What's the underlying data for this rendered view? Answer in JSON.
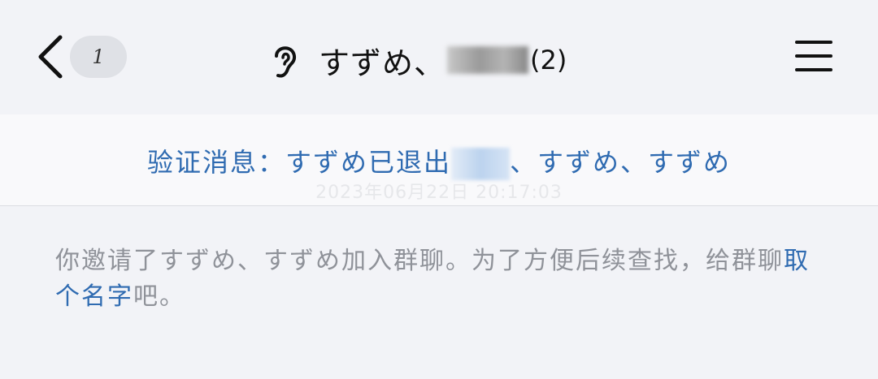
{
  "header": {
    "back_badge": "1",
    "title_prefix": "すずめ、",
    "title_suffix": "(2)",
    "icons": {
      "back": "chevron-left-icon",
      "voice": "ear-icon",
      "menu": "hamburger-menu-icon"
    }
  },
  "notice": {
    "timestamp": "2023年06月22日 20:17:03",
    "message_prefix": "验证消息：すずめ已退出",
    "message_suffix": "、すずめ、すずめ"
  },
  "system_message": {
    "text": "你邀请了すずめ、すずめ加入群聊。为了方便后续查找，给群聊",
    "link_text": "取个名字",
    "tail": "吧。"
  },
  "colors": {
    "background": "#f2f3f7",
    "accent_link": "#2f6bb1",
    "system_text": "#8f9299",
    "badge_bg": "#dfe1e6"
  }
}
